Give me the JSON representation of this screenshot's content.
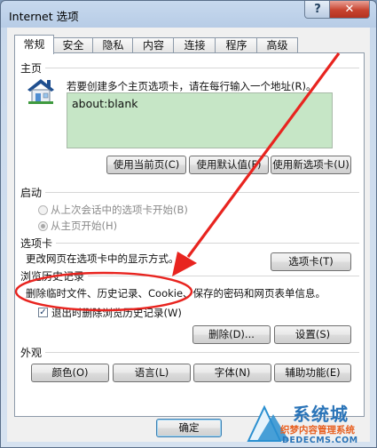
{
  "window": {
    "title": "Internet 选项"
  },
  "tabs": [
    {
      "label": "常规",
      "active": true
    },
    {
      "label": "安全"
    },
    {
      "label": "隐私"
    },
    {
      "label": "内容"
    },
    {
      "label": "连接"
    },
    {
      "label": "程序"
    },
    {
      "label": "高级"
    }
  ],
  "home": {
    "heading": "主页",
    "description": "若要创建多个主页选项卡，请在每行输入一个地址(R)。",
    "url": "about:blank",
    "buttons": [
      "使用当前页(C)",
      "使用默认值(F)",
      "使用新选项卡(U)"
    ]
  },
  "startup": {
    "heading": "启动",
    "option_last_session": "从上次会话中的选项卡开始(B)",
    "option_home": "从主页开始(H)"
  },
  "tabs_section": {
    "heading": "选项卡",
    "description": "更改网页在选项卡中的显示方式。",
    "button": "选项卡(T)"
  },
  "history": {
    "heading": "浏览历史记录",
    "description": "删除临时文件、历史记录、Cookie、保存的密码和网页表单信息。",
    "checkbox_label": "退出时删除浏览历史记录(W)",
    "checked": true,
    "delete_button": "删除(D)...",
    "settings_button": "设置(S)"
  },
  "appearance": {
    "heading": "外观",
    "buttons": [
      "颜色(O)",
      "语言(L)",
      "字体(N)",
      "辅助功能(E)"
    ]
  },
  "footer": {
    "ok": "确定"
  },
  "watermark": {
    "line1": "系统城",
    "line2": "织梦内容管理系统",
    "line3": "DEDECMS.COM"
  },
  "colors": {
    "annotation": "#e8241f",
    "homebox": "#c6e6c6",
    "ok_border": "#3c7fb1"
  }
}
